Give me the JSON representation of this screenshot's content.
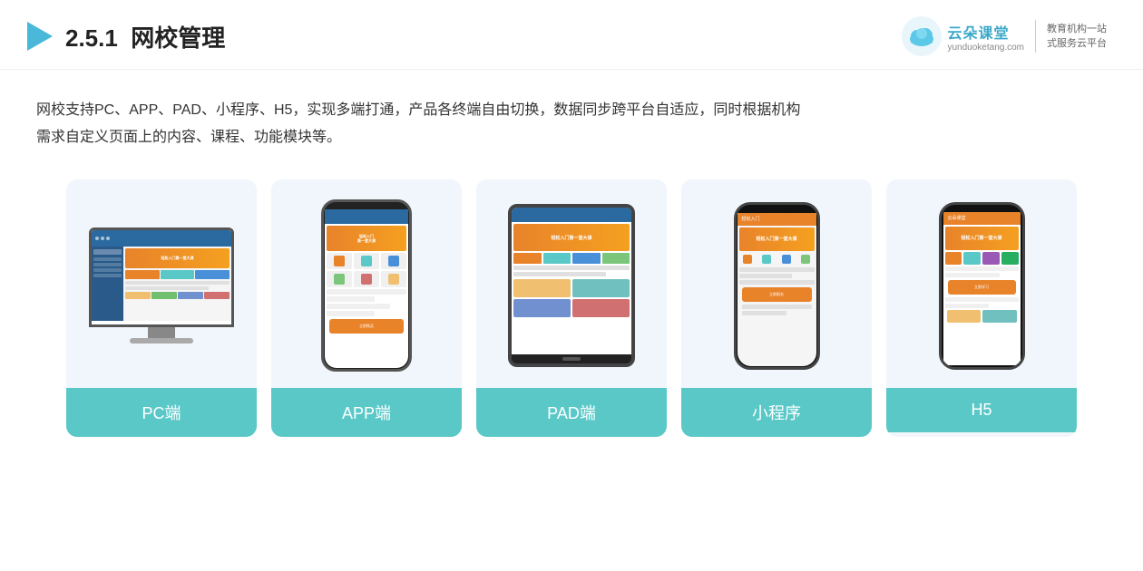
{
  "header": {
    "section_number": "2.5.1",
    "title": "网校管理",
    "brand": {
      "name": "云朵课堂",
      "domain": "yunduoketang.com",
      "slogan_line1": "教育机构一站",
      "slogan_line2": "式服务云平台"
    }
  },
  "description": {
    "text_line1": "网校支持PC、APP、PAD、小程序、H5，实现多端打通，产品各终端自由切换，数据同步跨平台自适应，同时根据机构",
    "text_line2": "需求自定义页面上的内容、课程、功能模块等。"
  },
  "cards": [
    {
      "id": "pc",
      "label": "PC端",
      "type": "monitor"
    },
    {
      "id": "app",
      "label": "APP端",
      "type": "phone"
    },
    {
      "id": "pad",
      "label": "PAD端",
      "type": "tablet"
    },
    {
      "id": "miniprogram",
      "label": "小程序",
      "type": "phone"
    },
    {
      "id": "h5",
      "label": "H5",
      "type": "phone"
    }
  ],
  "colors": {
    "teal": "#5bc8c8",
    "blue": "#4a90d9",
    "orange": "#e8832a",
    "light_bg": "#f0f6fb",
    "text_dark": "#333333"
  }
}
